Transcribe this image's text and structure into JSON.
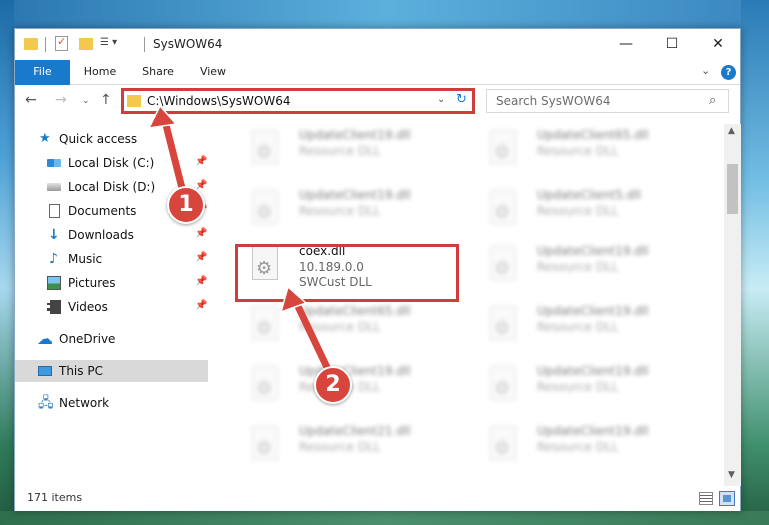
{
  "window": {
    "title": "SysWOW64",
    "controls": {
      "minimize": "—",
      "maximize": "☐",
      "close": "✕"
    }
  },
  "quick_access_toolbar": {
    "menu": "▾"
  },
  "ribbon": {
    "tabs": [
      "File",
      "Home",
      "Share",
      "View"
    ],
    "expand_icon": "chevron-down-icon",
    "help_label": "?"
  },
  "navigation": {
    "back": "←",
    "forward": "→",
    "recent": "⌄",
    "up": "↑",
    "address": "C:\\Windows\\SysWOW64",
    "refresh": "↻",
    "search_placeholder": "Search SysWOW64",
    "search_icon": "⌕"
  },
  "sidebar": {
    "items": [
      {
        "label": "Quick access",
        "icon": "star-icon",
        "pinned": false
      },
      {
        "label": "Local Disk (C:)",
        "icon": "disk-icon",
        "pinned": true
      },
      {
        "label": "Local Disk (D:)",
        "icon": "disk-icon",
        "pinned": true
      },
      {
        "label": "Documents",
        "icon": "documents-icon",
        "pinned": true
      },
      {
        "label": "Downloads",
        "icon": "downloads-icon",
        "pinned": true
      },
      {
        "label": "Music",
        "icon": "music-icon",
        "pinned": true
      },
      {
        "label": "Pictures",
        "icon": "pictures-icon",
        "pinned": true
      },
      {
        "label": "Videos",
        "icon": "videos-icon",
        "pinned": true
      },
      {
        "label": "OneDrive",
        "icon": "onedrive-icon",
        "pinned": false
      },
      {
        "label": "This PC",
        "icon": "this-pc-icon",
        "pinned": false,
        "selected": true
      },
      {
        "label": "Network",
        "icon": "network-icon",
        "pinned": false
      }
    ]
  },
  "files": [
    {
      "name": "UpdateClient19.dll",
      "type": "Resource DLL",
      "blurred": true
    },
    {
      "name": "UpdateClient65.dll",
      "type": "Resource DLL",
      "blurred": true
    },
    {
      "name": "UpdateClient19.dll",
      "type": "Resource DLL",
      "blurred": true
    },
    {
      "name": "UpdateClient5.dll",
      "type": "Resource DLL",
      "blurred": true
    },
    {
      "name": "coex.dll",
      "version": "10.189.0.0",
      "type": "SWCust DLL",
      "blurred": false
    },
    {
      "name": "UpdateClient19.dll",
      "type": "Resource DLL",
      "blurred": true
    },
    {
      "name": "UpdateClient65.dll",
      "type": "Resource DLL",
      "blurred": true
    },
    {
      "name": "UpdateClient19.dll",
      "type": "Resource DLL",
      "blurred": true
    },
    {
      "name": "UpdateClient19.dll",
      "type": "Resource DLL",
      "blurred": true
    },
    {
      "name": "UpdateClient19.dll",
      "type": "Resource DLL",
      "blurred": true
    },
    {
      "name": "UpdateClient21.dll",
      "type": "Resource DLL",
      "blurred": true
    },
    {
      "name": "UpdateClient19.dll",
      "type": "Resource DLL",
      "blurred": true
    }
  ],
  "status": {
    "item_count": "171 items"
  },
  "annotations": {
    "step1": "1",
    "step2": "2",
    "highlight_color": "#cf3d3d"
  }
}
